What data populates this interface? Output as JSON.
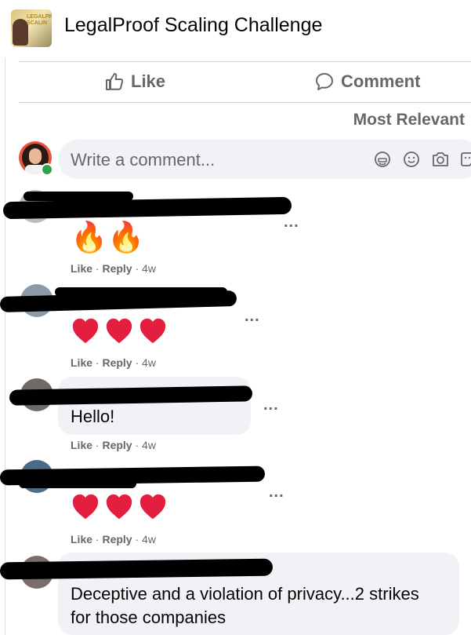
{
  "header": {
    "title": "LegalProof Scaling Challenge",
    "thumb_text": "LEGALPR SCALIN"
  },
  "actions": {
    "like_label": "Like",
    "comment_label": "Comment"
  },
  "sort": {
    "label": "Most Relevant"
  },
  "composer": {
    "placeholder": "Write a comment..."
  },
  "meta_labels": {
    "like": "Like",
    "reply": "Reply",
    "sep": "·"
  },
  "comments": [
    {
      "content": "🔥🔥",
      "age": "4w"
    },
    {
      "content": "hearts",
      "age": "4w"
    },
    {
      "content": "Hello!",
      "age": "4w"
    },
    {
      "content": "hearts",
      "age": "4w"
    },
    {
      "content": "Deceptive and a violation of privacy...2 strikes for those companies",
      "line1": "Deceptive and a violation of privacy...2 strikes",
      "line2": "for those companies"
    }
  ],
  "more_options": "...",
  "colors": {
    "accent_gray": "#65676b",
    "bubble": "#f0f2f5",
    "heart_red": "#e41e3f",
    "online": "#31a24c"
  }
}
